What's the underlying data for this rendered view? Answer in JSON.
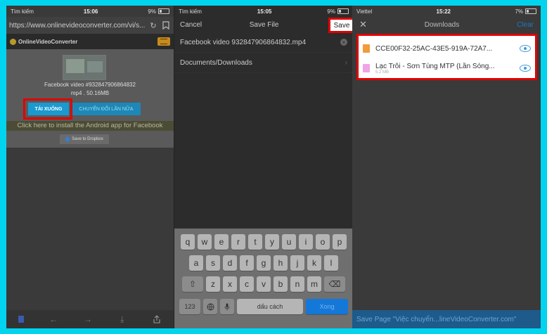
{
  "panel1": {
    "status": {
      "carrier": "Tìm kiếm",
      "time": "15:06",
      "battery": "9%"
    },
    "url": "https://www.onlinevideoconverter.com/vi/s...",
    "site_logo": "OnlineVideoConverter",
    "video_name": "Facebook video #932847906864832",
    "video_meta": "mp4 . 50.16MB",
    "download_label": "TẢI XUỐNG",
    "convert_label": "CHUYỂN ĐỔI LẦN NỮA",
    "android_banner": "Click here to install the Android app for Facebook",
    "dropbox_label": "Save to Dropbox"
  },
  "panel2": {
    "status": {
      "carrier": "Tìm kiếm",
      "time": "15:05",
      "battery": "9%"
    },
    "cancel_label": "Cancel",
    "title": "Save File",
    "save_label": "Save",
    "filename": "Facebook video 932847906864832.mp4",
    "folder": "Documents/Downloads",
    "keyboard": {
      "row1": [
        "q",
        "w",
        "e",
        "r",
        "t",
        "y",
        "u",
        "i",
        "o",
        "p"
      ],
      "row2": [
        "a",
        "s",
        "d",
        "f",
        "g",
        "h",
        "j",
        "k",
        "l"
      ],
      "row3": [
        "z",
        "x",
        "c",
        "v",
        "b",
        "n",
        "m"
      ],
      "numbers_label": "123",
      "space_label": "dấu cách",
      "go_label": "Xong"
    }
  },
  "panel3": {
    "status": {
      "carrier": "Viettel",
      "time": "15:22",
      "battery": "7%"
    },
    "title": "Downloads",
    "clear_label": "Clear",
    "items": [
      {
        "name": "CCE00F32-25AC-43E5-919A-72A7...",
        "size": ""
      },
      {
        "name": "Lạc Trôi - Sơn Tùng MTP (Lần Sóng...",
        "size": "5.2 MB"
      }
    ],
    "bottom_bar": "Save Page \"Việc chuyển...lineVideoConverter.com\""
  }
}
